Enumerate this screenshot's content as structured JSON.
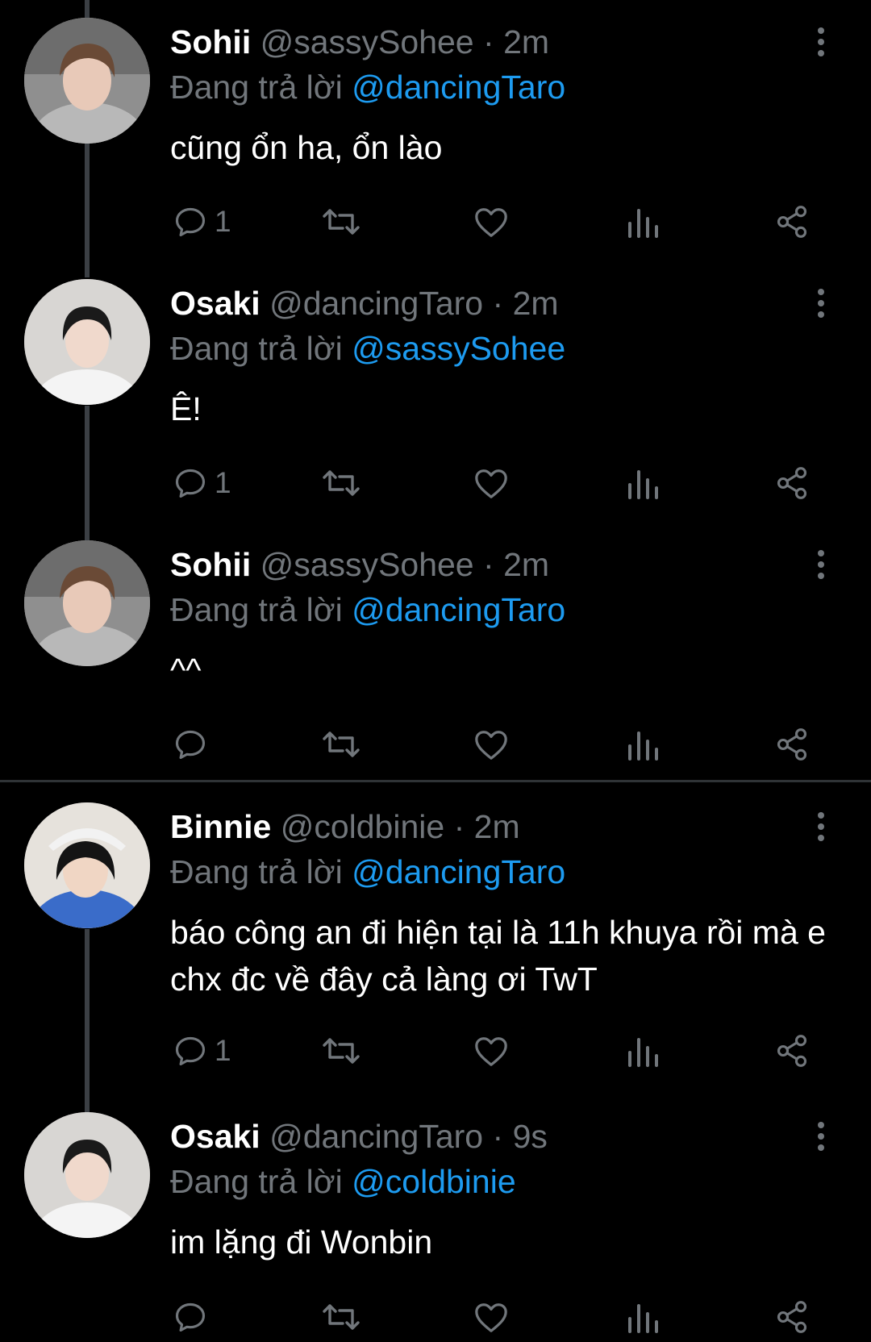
{
  "colors": {
    "background": "#000000",
    "text": "#ffffff",
    "secondary": "#71767b",
    "mention": "#1d9bf0",
    "thread_line": "#3b3f44",
    "divider": "#2f3336"
  },
  "icons": {
    "reply": "speech-bubble-icon",
    "retweet": "retweet-arrows-icon",
    "like": "heart-icon",
    "views": "bar-chart-icon",
    "share": "share-nodes-icon",
    "more": "vertical-ellipsis-icon"
  },
  "reply_prefix": "Đang trả lời",
  "tweets": [
    {
      "name": "Sohii",
      "handle": "@sassySohee",
      "sep": "·",
      "time": "2m",
      "reply_to": "@dancingTaro",
      "text": "cũng ổn ha, ổn lào",
      "reply_count": "1"
    },
    {
      "name": "Osaki",
      "handle": "@dancingTaro",
      "sep": "·",
      "time": "2m",
      "reply_to": "@sassySohee",
      "text": "Ê!",
      "reply_count": "1"
    },
    {
      "name": "Sohii",
      "handle": "@sassySohee",
      "sep": "·",
      "time": "2m",
      "reply_to": "@dancingTaro",
      "text": "^^",
      "reply_count": ""
    },
    {
      "name": "Binnie",
      "handle": "@coldbinie",
      "sep": "·",
      "time": "2m",
      "reply_to": "@dancingTaro",
      "text": "báo công an đi hiện tại là 11h khuya rồi mà e chx đc về đây cả làng ơi TwT",
      "reply_count": "1"
    },
    {
      "name": "Osaki",
      "handle": "@dancingTaro",
      "sep": "·",
      "time": "9s",
      "reply_to": "@coldbinie",
      "text": "im lặng đi Wonbin",
      "reply_count": ""
    }
  ]
}
